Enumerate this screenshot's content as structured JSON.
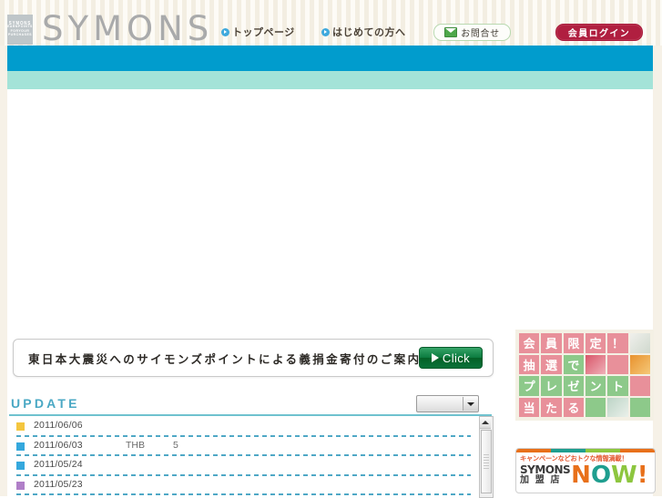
{
  "header": {
    "logo": {
      "badge_title": "SYMONS",
      "badge_line1": "EARNPOINTS",
      "badge_line2": "FORYOUR",
      "badge_line3": "PURCHASES",
      "wordmark": "SYMONS"
    },
    "nav": [
      {
        "label": "トップページ",
        "name": "nav-top"
      },
      {
        "label": "はじめての方へ",
        "name": "nav-first"
      }
    ],
    "contact_label": "お問合せ",
    "login_label": "会員ログイン"
  },
  "banner": {
    "donation_text": "東日本大震災へのサイモンズポイントによる義捐金寄付のご案内",
    "click_label": "Click"
  },
  "update": {
    "title": "UPDATE",
    "filter_value": "",
    "rows": [
      {
        "marker_color": "#f4c63f",
        "marker": "yellow",
        "date": "2011/06/06",
        "currency": "",
        "amount": ""
      },
      {
        "marker_color": "#35a8dd",
        "marker": "blue",
        "date": "2011/06/03",
        "currency": "THB",
        "amount": "5"
      },
      {
        "marker_color": "#35a8dd",
        "marker": "blue",
        "date": "2011/05/24",
        "currency": "",
        "amount": ""
      },
      {
        "marker_color": "#b07fc8",
        "marker": "purple",
        "date": "2011/05/23",
        "currency": "",
        "amount": ""
      }
    ]
  },
  "sidebar": {
    "tile_banner": {
      "tiles": [
        {
          "t": "会",
          "k": "pink"
        },
        {
          "t": "員",
          "k": "pink"
        },
        {
          "t": "限",
          "k": "pink"
        },
        {
          "t": "定",
          "k": "pink"
        },
        {
          "t": "！",
          "k": "pink"
        },
        {
          "t": "",
          "k": "ph1"
        },
        {
          "t": "抽",
          "k": "pink"
        },
        {
          "t": "選",
          "k": "pink"
        },
        {
          "t": "で",
          "k": "green"
        },
        {
          "t": "",
          "k": "ph2"
        },
        {
          "t": "",
          "k": "pink"
        },
        {
          "t": "",
          "k": "ph3"
        },
        {
          "t": "プ",
          "k": "green"
        },
        {
          "t": "レ",
          "k": "green"
        },
        {
          "t": "ゼ",
          "k": "green"
        },
        {
          "t": "ン",
          "k": "green"
        },
        {
          "t": "ト",
          "k": "green"
        },
        {
          "t": "",
          "k": "pink"
        },
        {
          "t": "当",
          "k": "pink"
        },
        {
          "t": "た",
          "k": "pink"
        },
        {
          "t": "る",
          "k": "pink"
        },
        {
          "t": "",
          "k": "green"
        },
        {
          "t": "",
          "k": "ph4"
        },
        {
          "t": "",
          "k": "green"
        }
      ]
    },
    "now_banner": {
      "tagline": "キャンペーンなどおトクな情報満載！",
      "brand": "SYMONS",
      "subtitle": "加 盟 店",
      "word": [
        "N",
        "O",
        "W",
        "!"
      ]
    }
  },
  "colors": {
    "bar_blue": "#019ccd",
    "bar_teal": "#a4e3d8",
    "accent_cyan": "#4aa8c4",
    "login_red": "#b01f40"
  }
}
